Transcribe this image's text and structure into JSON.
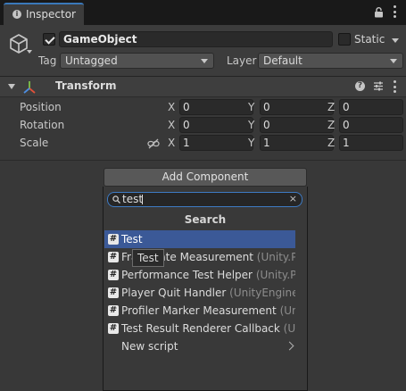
{
  "tab": {
    "title": "Inspector"
  },
  "header": {
    "object_name": "GameObject",
    "static_label": "Static",
    "tag_label": "Tag",
    "tag_value": "Untagged",
    "layer_label": "Layer",
    "layer_value": "Default"
  },
  "transform": {
    "title": "Transform",
    "rows": [
      {
        "label": "Position",
        "x": "0",
        "y": "0",
        "z": "0"
      },
      {
        "label": "Rotation",
        "x": "0",
        "y": "0",
        "z": "0"
      },
      {
        "label": "Scale",
        "x": "1",
        "y": "1",
        "z": "1"
      }
    ],
    "axis_labels": {
      "x": "X",
      "y": "Y",
      "z": "Z"
    }
  },
  "add_component": {
    "button_label": "Add Component",
    "search_value": "test",
    "clear_glyph": "×",
    "section_title": "Search",
    "items": [
      {
        "name": "Test",
        "ns": "",
        "selected": true
      },
      {
        "name": "Framerate Measurement",
        "ns": "(Unity.Perfo"
      },
      {
        "name": "Performance Test Helper",
        "ns": "(Unity.Perfo"
      },
      {
        "name": "Player Quit Handler",
        "ns": "(UnityEngine.Test"
      },
      {
        "name": "Profiler Marker Measurement",
        "ns": "(Unity.P"
      },
      {
        "name": "Test Result Renderer Callback",
        "ns": "(Unity"
      }
    ],
    "new_script_label": "New script",
    "tooltip": "Test"
  },
  "colors": {
    "accent": "#3e7bc4",
    "selection": "#3b5997",
    "panel": "#383838"
  }
}
